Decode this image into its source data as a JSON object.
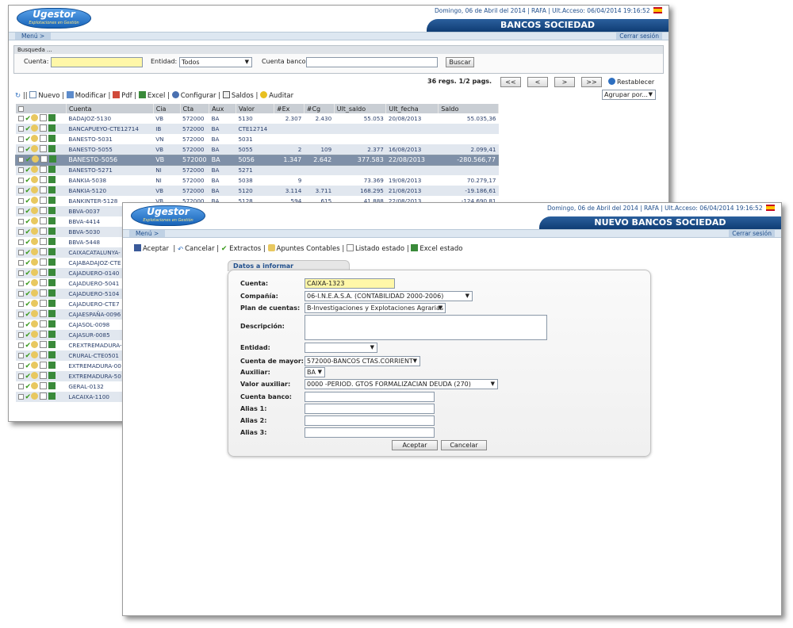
{
  "common": {
    "logo_title": "Ugestor",
    "logo_sub": "Explotaciones en Gestión",
    "date": "Domingo, 06 de Abril del 2014",
    "user": "RAFA",
    "last_access": "Ult.Acceso: 06/04/2014 19:16:52",
    "menu": "Menú >",
    "logout": "Cerrar sesión"
  },
  "list_window": {
    "title": "BANCOS SOCIEDAD",
    "search": {
      "heading": "Busqueda ...",
      "cuenta_label": "Cuenta:",
      "cuenta_value": "",
      "entidad_label": "Entidad:",
      "entidad_value": "Todos",
      "cuenta_banco_label": "Cuenta banco:",
      "cuenta_banco_value": "",
      "buscar": "Buscar"
    },
    "pager": {
      "info": "36 regs. 1/2 pags.",
      "first": "<<",
      "prev": "<",
      "next": ">",
      "last": ">>",
      "reset": "Restablecer"
    },
    "toolbar": {
      "sep": "||",
      "nuevo": "Nuevo",
      "modificar": "Modificar",
      "pdf": "Pdf",
      "excel": "Excel",
      "configurar": "Configurar",
      "saldos": "Saldos",
      "auditar": "Auditar",
      "agrupar": "Agrupar por..."
    },
    "columns": [
      "Cuenta",
      "Cia",
      "Cta",
      "Aux",
      "Valor",
      "#Ex",
      "#Cg",
      "Ult_saldo",
      "Ult_fecha",
      "Saldo"
    ],
    "rows": [
      [
        "BADAJOZ-5130",
        "VB",
        "572000",
        "BA",
        "5130",
        "2.307",
        "2.430",
        "55.053",
        "20/08/2013",
        "55.035,36"
      ],
      [
        "BANCAPUEYO-CTE12714",
        "IB",
        "572000",
        "BA",
        "CTE12714",
        "",
        "",
        "",
        "",
        ""
      ],
      [
        "BANESTO-5031",
        "VN",
        "572000",
        "BA",
        "5031",
        "",
        "",
        "",
        "",
        ""
      ],
      [
        "BANESTO-5055",
        "VB",
        "572000",
        "BA",
        "5055",
        "2",
        "109",
        "2.377",
        "16/08/2013",
        "2.099,41"
      ],
      [
        "BANESTO-5056",
        "VB",
        "572000",
        "BA",
        "5056",
        "1.347",
        "2.642",
        "377.583",
        "22/08/2013",
        "-280.566,77"
      ],
      [
        "BANESTO-5271",
        "NI",
        "572000",
        "BA",
        "5271",
        "",
        "",
        "",
        "",
        ""
      ],
      [
        "BANKIA-5038",
        "NI",
        "572000",
        "BA",
        "5038",
        "9",
        "",
        "73.369",
        "19/08/2013",
        "70.279,17"
      ],
      [
        "BANKIA-5120",
        "VB",
        "572000",
        "BA",
        "5120",
        "3.114",
        "3.711",
        "168.295",
        "21/08/2013",
        "-19.186,61"
      ],
      [
        "BANKINTER-5128",
        "VB",
        "572000",
        "BA",
        "5128",
        "594",
        "615",
        "41.888",
        "22/08/2013",
        "-124.690,81"
      ],
      [
        "BBVA-0037",
        "",
        "",
        "",
        "",
        "",
        "",
        "",
        "",
        ""
      ],
      [
        "BBVA-4414",
        "",
        "",
        "",
        "",
        "",
        "",
        "",
        "",
        ""
      ],
      [
        "BBVA-5030",
        "",
        "",
        "",
        "",
        "",
        "",
        "",
        "",
        ""
      ],
      [
        "BBVA-5448",
        "",
        "",
        "",
        "",
        "",
        "",
        "",
        "",
        ""
      ],
      [
        "CAIXACATALUNYA-",
        "",
        "",
        "",
        "",
        "",
        "",
        "",
        "",
        ""
      ],
      [
        "CAJABADAJOZ-CTE",
        "",
        "",
        "",
        "",
        "",
        "",
        "",
        "",
        ""
      ],
      [
        "CAJADUERO-0140",
        "",
        "",
        "",
        "",
        "",
        "",
        "",
        "",
        ""
      ],
      [
        "CAJADUERO-5041",
        "",
        "",
        "",
        "",
        "",
        "",
        "",
        "",
        ""
      ],
      [
        "CAJADUERO-5104",
        "",
        "",
        "",
        "",
        "",
        "",
        "",
        "",
        ""
      ],
      [
        "CAJADUERO-CTE7",
        "",
        "",
        "",
        "",
        "",
        "",
        "",
        "",
        ""
      ],
      [
        "CAJAESPAÑA-0096",
        "",
        "",
        "",
        "",
        "",
        "",
        "",
        "",
        ""
      ],
      [
        "CAJASOL-0098",
        "",
        "",
        "",
        "",
        "",
        "",
        "",
        "",
        ""
      ],
      [
        "CAJASUR-0085",
        "",
        "",
        "",
        "",
        "",
        "",
        "",
        "",
        ""
      ],
      [
        "CREXTREMADURA-",
        "",
        "",
        "",
        "",
        "",
        "",
        "",
        "",
        ""
      ],
      [
        "CRURAL-CTE0501",
        "",
        "",
        "",
        "",
        "",
        "",
        "",
        "",
        ""
      ],
      [
        "EXTREMADURA-00",
        "",
        "",
        "",
        "",
        "",
        "",
        "",
        "",
        ""
      ],
      [
        "EXTREMADURA-50",
        "",
        "",
        "",
        "",
        "",
        "",
        "",
        "",
        ""
      ],
      [
        "GERAL-0132",
        "",
        "",
        "",
        "",
        "",
        "",
        "",
        "",
        ""
      ],
      [
        "LACAIXA-1100",
        "",
        "",
        "",
        "",
        "",
        "",
        "",
        "",
        ""
      ]
    ]
  },
  "form_window": {
    "title": "NUEVO BANCOS SOCIEDAD",
    "toolbar": {
      "aceptar": "Aceptar",
      "cancelar": "Cancelar",
      "extractos": "Extractos",
      "apuntes": "Apuntes Contables",
      "listado": "Listado estado",
      "excel": "Excel estado"
    },
    "tab": "Datos a informar",
    "fields": {
      "cuenta_label": "Cuenta:",
      "cuenta_value": "CAIXA-1323",
      "compania_label": "Compañía:",
      "compania_value": "06-I.N.E.A.S.A. (CONTABILIDAD 2000-2006)",
      "plan_label": "Plan de cuentas:",
      "plan_value": "B-Investigaciones y Explotaciones Agrarias",
      "descripcion_label": "Descripción:",
      "descripcion_value": "",
      "entidad_label": "Entidad:",
      "entidad_value": "",
      "mayor_label": "Cuenta de mayor:",
      "mayor_value": "572000-BANCOS CTAS.CORRIENT",
      "auxiliar_label": "Auxiliar:",
      "auxiliar_value": "BA",
      "valor_aux_label": "Valor auxiliar:",
      "valor_aux_value": "0000 -PERIOD. GTOS FORMALIZACIAN DEUDA (270)",
      "cuenta_banco_label": "Cuenta banco:",
      "alias1_label": "Alias 1:",
      "alias2_label": "Alias 2:",
      "alias3_label": "Alias 3:"
    },
    "buttons": {
      "aceptar": "Aceptar",
      "cancelar": "Cancelar"
    }
  },
  "colors": {
    "brand_blue": "#1763b8",
    "title_bar": "#0f3d74",
    "row_alt": "#e1e7ef",
    "row_selected": "#7f90a8",
    "highlight_input": "#fff7a8"
  }
}
